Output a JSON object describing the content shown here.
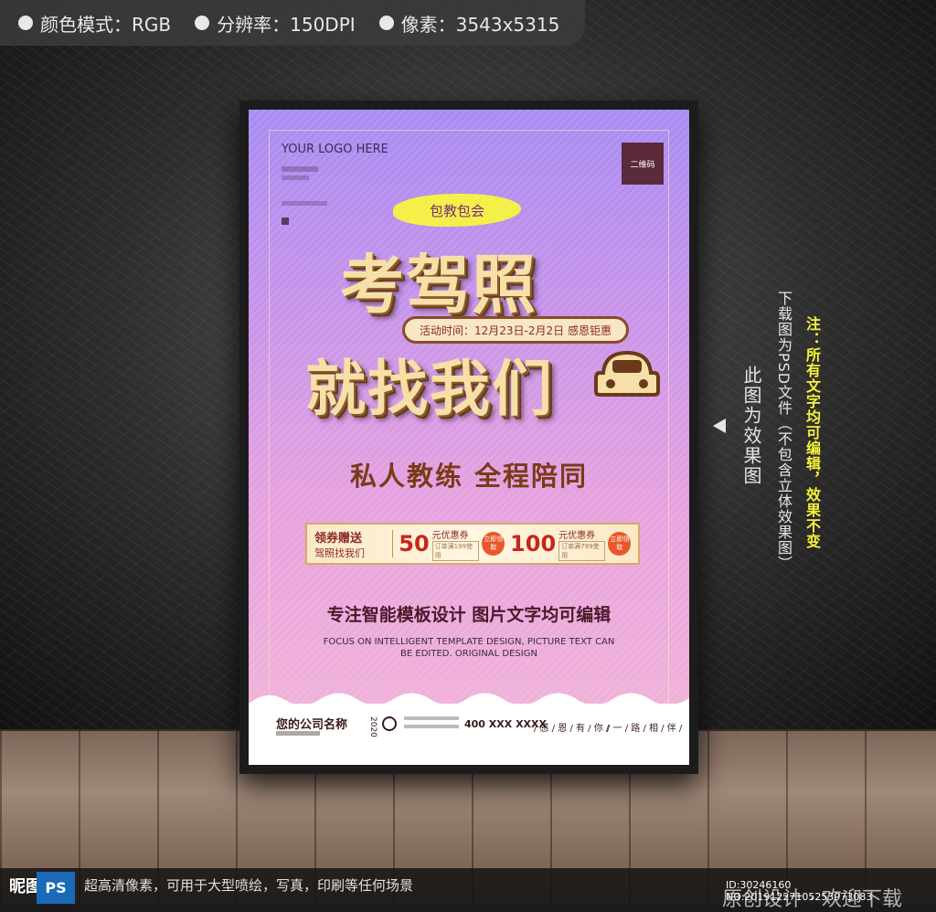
{
  "specs": [
    {
      "label": "颜色模式：RGB"
    },
    {
      "label": "分辨率：150DPI"
    },
    {
      "label": "像素：3543x5315"
    }
  ],
  "poster": {
    "logo": "YOUR LOGO HERE",
    "qr_label": "二维码",
    "badge": "包教包会",
    "title_line1": "考驾照",
    "title_line2": "就找我们",
    "date": "活动时间：12月23日-2月2日 感恩钜惠",
    "subtitle": "私人教练 全程陪同",
    "coupon": {
      "left_line1": "领券赠送",
      "left_line2": "驾照找我们",
      "items": [
        {
          "amount": "50",
          "title": "元优惠券",
          "condition": "订单满199使用",
          "claim": "立即领取"
        },
        {
          "amount": "100",
          "title": "元优惠券",
          "condition": "订单满799使用",
          "claim": "立即领取"
        }
      ]
    },
    "focus_cn": "专注智能模板设计 图片文字均可编辑",
    "focus_en_line1": "FOCUS ON INTELLIGENT TEMPLATE DESIGN, PICTURE TEXT CAN",
    "focus_en_line2": "BE EDITED. ORIGINAL DESIGN",
    "footer": {
      "company": "您的公司名称",
      "year": "2020",
      "phone": "400 XXX XXXX",
      "slogan1": "/ 感 / 恩 / 有 / 你 /",
      "slogan2": "/ 一 / 路 / 相 / 伴 /"
    }
  },
  "side": {
    "note": "注：所有文字均可编辑，效果不变",
    "download": "下载图为PSD文件（不包含立体效果图）",
    "effect": "此图为效果图"
  },
  "bottom": {
    "site": "昵图网",
    "ps": "PS",
    "desc": "超高清像素，可用于大型喷绘，写真，印刷等任何场景",
    "id": "ID:30246160 NO:20191227105253973083",
    "orig": "原创设计 · 欢迎下载"
  },
  "colors": {
    "title_face": "#f6e0a8",
    "accent_red": "#c8261a",
    "note_yellow": "#f6f23a"
  }
}
